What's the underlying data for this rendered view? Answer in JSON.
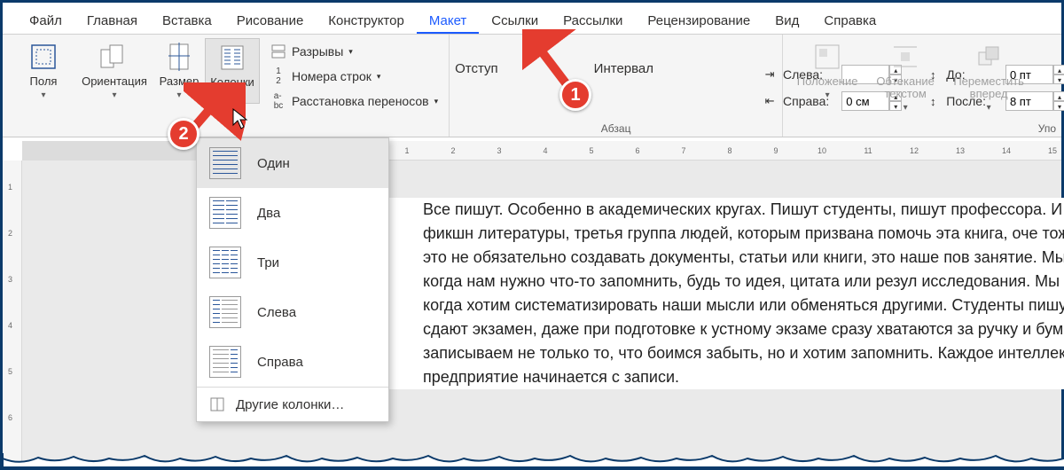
{
  "tabs": {
    "items": [
      "Файл",
      "Главная",
      "Вставка",
      "Рисование",
      "Конструктор",
      "Макет",
      "Ссылки",
      "Рассылки",
      "Рецензирование",
      "Вид",
      "Справка"
    ],
    "active": 5
  },
  "ribbon": {
    "page_setup": {
      "margins": "Поля",
      "orientation": "Ориентация",
      "size": "Размер",
      "columns": "Колонки",
      "breaks": "Разрывы",
      "line_numbers": "Номера строк",
      "hyphenation": "Расстановка переносов"
    },
    "indent": {
      "header": "Отступ",
      "left_label": "Слева:",
      "left_value": "",
      "right_label": "Справа:",
      "right_value": "0 см"
    },
    "spacing": {
      "header": "Интервал",
      "before_label": "До:",
      "before_value": "0 пт",
      "after_label": "После:",
      "after_value": "8 пт"
    },
    "paragraph_label": "Абзац",
    "arrange": {
      "position": "Положение",
      "wrap": "Обтекание текстом",
      "bring_forward": "Переместить вперед"
    },
    "truncated": "Упо"
  },
  "columns_menu": {
    "items": [
      {
        "label": "Один",
        "cols": 1,
        "narrow": null
      },
      {
        "label": "Два",
        "cols": 2,
        "narrow": null
      },
      {
        "label": "Три",
        "cols": 3,
        "narrow": null
      },
      {
        "label": "Слева",
        "cols": 2,
        "narrow": "left"
      },
      {
        "label": "Справа",
        "cols": 2,
        "narrow": "right"
      }
    ],
    "more": "Другие колонки…",
    "selected": 0
  },
  "document_text": "Все пишут. Особенно в академических кругах. Пишут студенты, пишут профессора. И авт нон-фикшн литературы, третья группа людей, которым призвана помочь эта книга, оче тоже. Писать – это не обязательно создавать документы, статьи или книги, это наше пов занятие. Мы пишем, когда нам нужно что-то запомнить, будь то идея, цитата или резул исследования. Мы пишем, когда хотим систематизировать наши мысли или обменяться другими. Студенты пишут, когда сдают экзамен, даже при подготовке к устному экзаме сразу хватаются за ручку и бумагу. Мы записываем не только то, что боимся забыть, но и хотим запомнить. Каждое интеллектуальное предприятие начинается с записи.",
  "ruler": {
    "h_start": 1,
    "h_end": 15,
    "v_start": 1,
    "v_end": 6
  },
  "callouts": {
    "one": "1",
    "two": "2"
  }
}
